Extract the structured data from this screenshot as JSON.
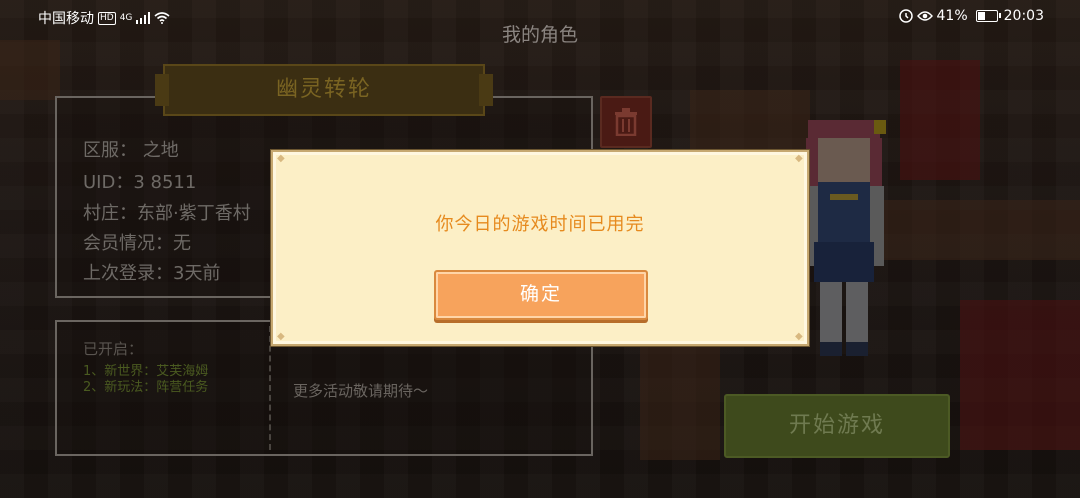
{
  "status_bar": {
    "carrier": "中国移动",
    "hd": "HD",
    "network": "4G",
    "battery_percent": "41%",
    "battery_level": 0.41,
    "time": "20:03"
  },
  "page": {
    "title": "我的角色"
  },
  "character": {
    "name": "幽灵转轮",
    "info": {
      "server": "区服：     之地",
      "uid": "UID：3   8511",
      "village": "村庄：东部·紫丁香村",
      "membership": "会员情况：无",
      "last_login": "上次登录：3天前"
    }
  },
  "news": {
    "title": "已开启：",
    "items": [
      "1、新世界：艾芙海姆",
      "2、新玩法：阵营任务"
    ],
    "more": "更多活动敬请期待～"
  },
  "start_button": {
    "label": "开始游戏"
  },
  "dialog": {
    "message": "你今日的游戏时间已用完",
    "confirm_label": "确定"
  },
  "colors": {
    "modal_bg": "#fcefc6",
    "message": "#e68a1e",
    "confirm_button": "#f7a35c"
  }
}
